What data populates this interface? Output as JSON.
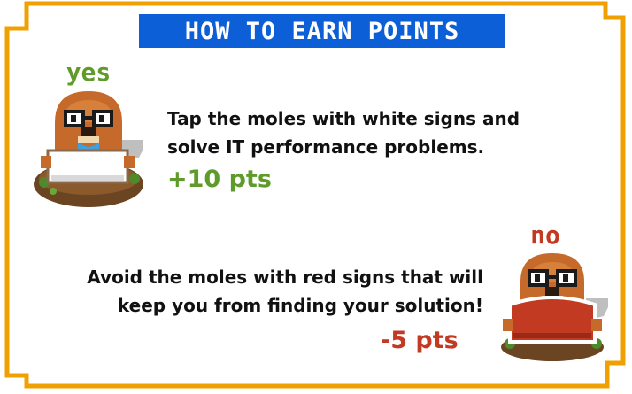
{
  "title": "HOW TO EARN POINTS",
  "yes_section": {
    "label": "yes",
    "line1": "Tap the moles with white signs and",
    "line2": "solve IT performance problems.",
    "points": "+10 pts"
  },
  "no_section": {
    "label": "no",
    "line1": "Avoid the moles with red signs that will",
    "line2": "keep you from finding your solution!",
    "points": "-5 pts"
  },
  "colors": {
    "border": "#f0a000",
    "title_bg": "#0c5fd6",
    "yes": "#5e9b2a",
    "no": "#c23a22",
    "white_sign": "#ffffff",
    "red_sign": "#c23a22"
  },
  "icons": [
    "mole-white-sign-icon",
    "mole-red-sign-icon"
  ]
}
